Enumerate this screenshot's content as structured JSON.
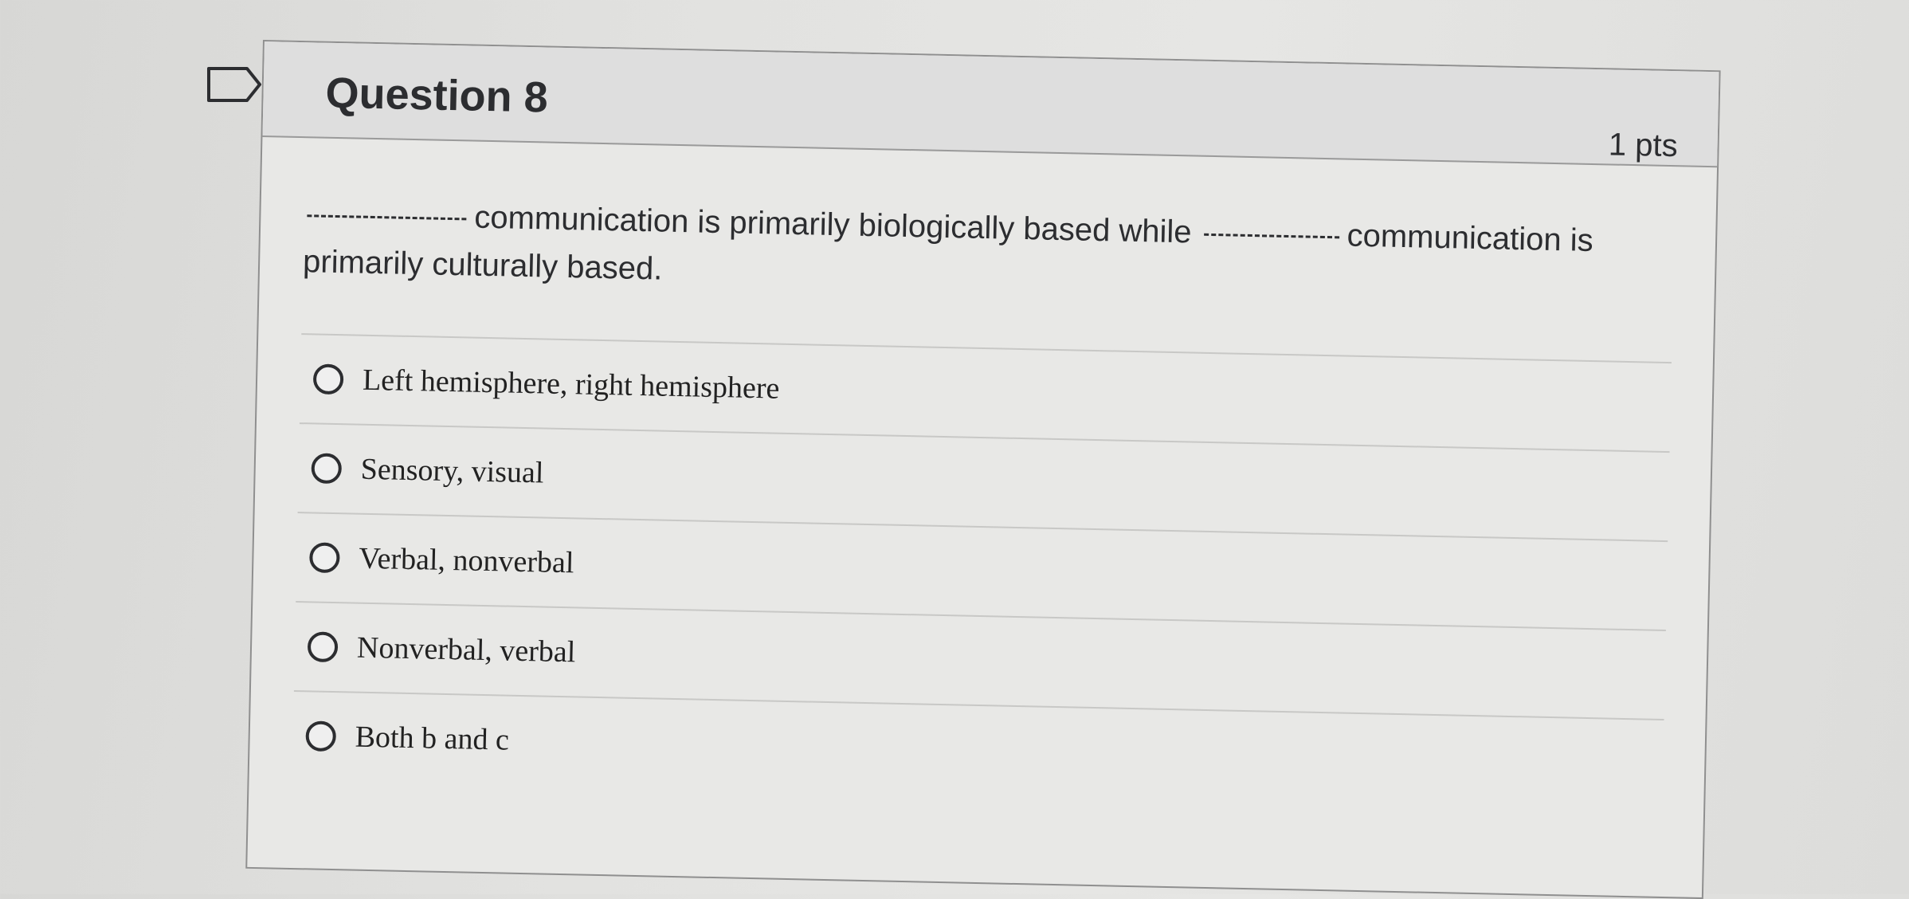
{
  "question": {
    "title": "Question 8",
    "points": "1 pts",
    "text_part1": "communication is primarily biologically based while",
    "text_part2": "communication is primarily culturally based."
  },
  "answers": [
    {
      "label": "Left hemisphere, right hemisphere"
    },
    {
      "label": "Sensory, visual"
    },
    {
      "label": "Verbal, nonverbal"
    },
    {
      "label": "Nonverbal, verbal"
    },
    {
      "label": "Both b and c"
    }
  ],
  "icons": {
    "flag": "flag-icon"
  },
  "colors": {
    "text": "#2c2d30",
    "border": "#8f8f8f",
    "header_bg": "#dedede"
  }
}
